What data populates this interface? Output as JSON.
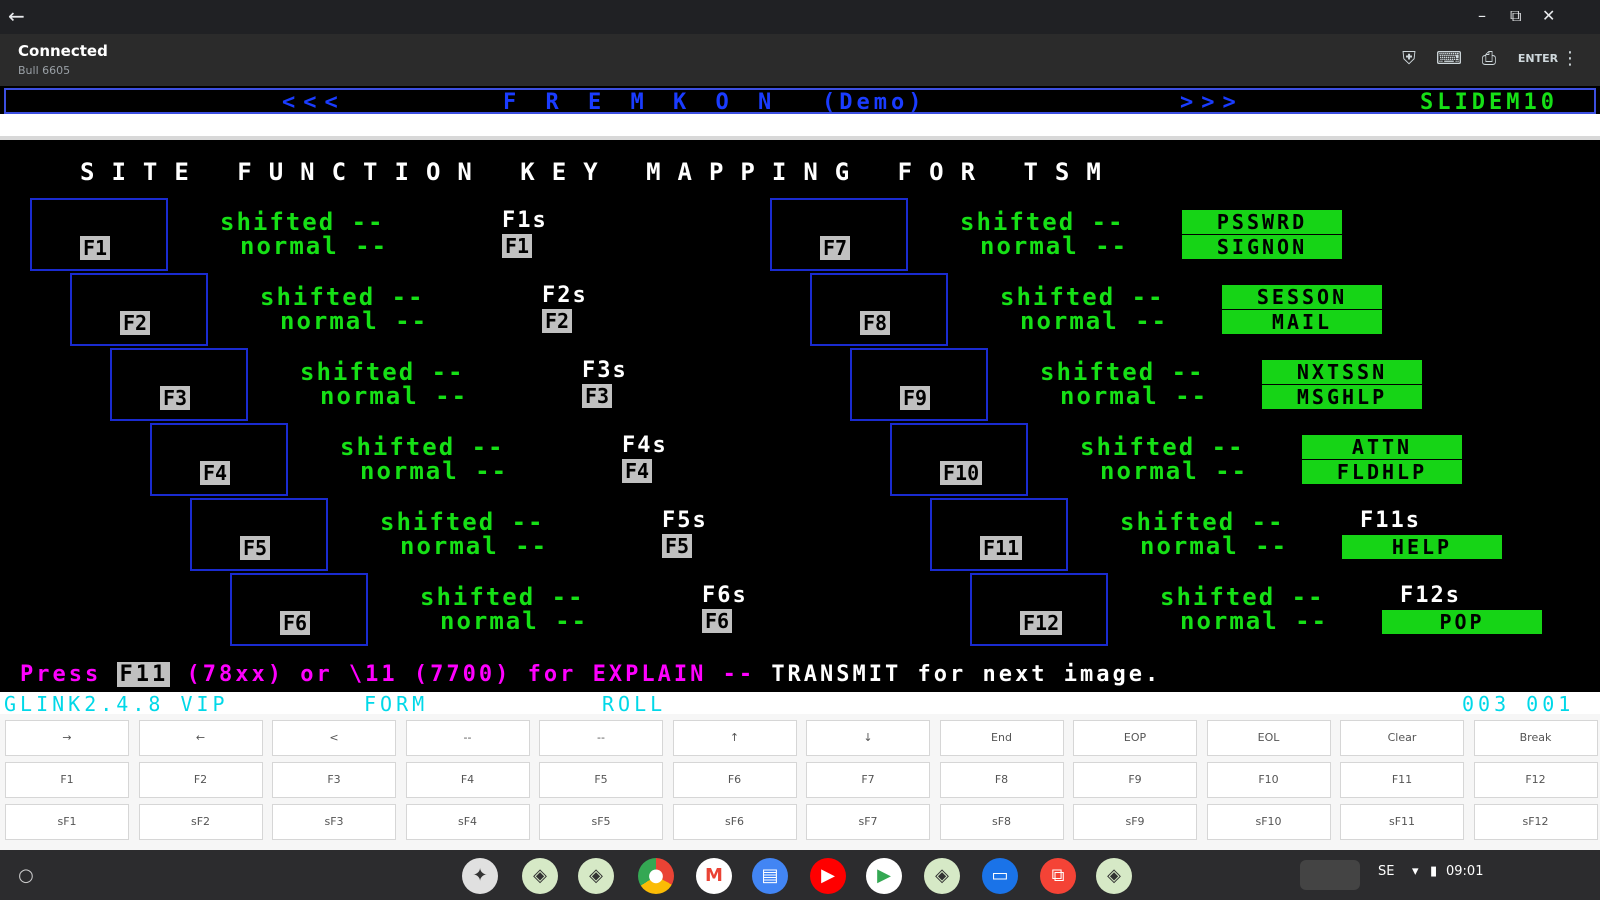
{
  "window": {
    "back_label": "←",
    "min_label": "–",
    "max_label": "⧉",
    "close_label": "✕"
  },
  "appbar": {
    "status": "Connected",
    "substatus": "Bull 6605",
    "enter_label": "ENTER",
    "menu_label": "⋮"
  },
  "terminal": {
    "header_left": "<<<",
    "header_center": "F R E M K O N",
    "header_demo": "(Demo)",
    "header_right": ">>>",
    "slide_id": "SLIDEM10",
    "title": "SITE FUNCTION KEY MAPPING FOR TSM",
    "shifted_label": "shifted --",
    "normal_label": "normal --",
    "left_keys": [
      {
        "key": "F1",
        "shifted": "F1s",
        "normal": "F1"
      },
      {
        "key": "F2",
        "shifted": "F2s",
        "normal": "F2"
      },
      {
        "key": "F3",
        "shifted": "F3s",
        "normal": "F3"
      },
      {
        "key": "F4",
        "shifted": "F4s",
        "normal": "F4"
      },
      {
        "key": "F5",
        "shifted": "F5s",
        "normal": "F5"
      },
      {
        "key": "F6",
        "shifted": "F6s",
        "normal": "F6"
      }
    ],
    "right_keys": [
      {
        "key": "F7",
        "shifted": "PSSWRD",
        "normal": "SIGNON"
      },
      {
        "key": "F8",
        "shifted": "SESSON",
        "normal": "MAIL"
      },
      {
        "key": "F9",
        "shifted": "NXTSSN",
        "normal": "MSGHLP"
      },
      {
        "key": "F10",
        "shifted": "ATTN",
        "normal": "FLDHLP"
      },
      {
        "key": "F11",
        "shifted": "F11s",
        "normal": "HELP"
      },
      {
        "key": "F12",
        "shifted": "F12s",
        "normal": "POP"
      }
    ],
    "press_prefix": "Press ",
    "press_key": "F11",
    "press_mid": " (78xx) or \\11 (7700) for EXPLAIN -- ",
    "press_suffix": "TRANSMIT for next image."
  },
  "statusline": {
    "emulator": "GLINK2.4.8 VIP",
    "mode1": "FORM",
    "mode2": "ROLL",
    "cursor": "003 001"
  },
  "keypad": {
    "row1": [
      "→",
      "←",
      "<",
      "--",
      "--",
      "↑",
      "↓",
      "End",
      "EOP",
      "EOL",
      "Clear",
      "Break"
    ],
    "row2": [
      "F1",
      "F2",
      "F3",
      "F4",
      "F5",
      "F6",
      "F7",
      "F8",
      "F9",
      "F10",
      "F11",
      "F12"
    ],
    "row3": [
      "sF1",
      "sF2",
      "sF3",
      "sF4",
      "sF5",
      "sF6",
      "sF7",
      "sF8",
      "sF9",
      "sF10",
      "sF11",
      "sF12"
    ]
  },
  "shelf": {
    "launcher_label": "○",
    "apps": [
      "chrome-icon",
      "gmail-icon",
      "docs-icon",
      "youtube-icon",
      "play-store-icon",
      "files-icon"
    ],
    "tray_time": "09:01",
    "tray_region": "SE"
  },
  "colors": {
    "terminal_green": "#16e016",
    "terminal_blue": "#1a3cff",
    "terminal_magenta": "#ff00ff",
    "status_cyan": "#00d8e8"
  }
}
